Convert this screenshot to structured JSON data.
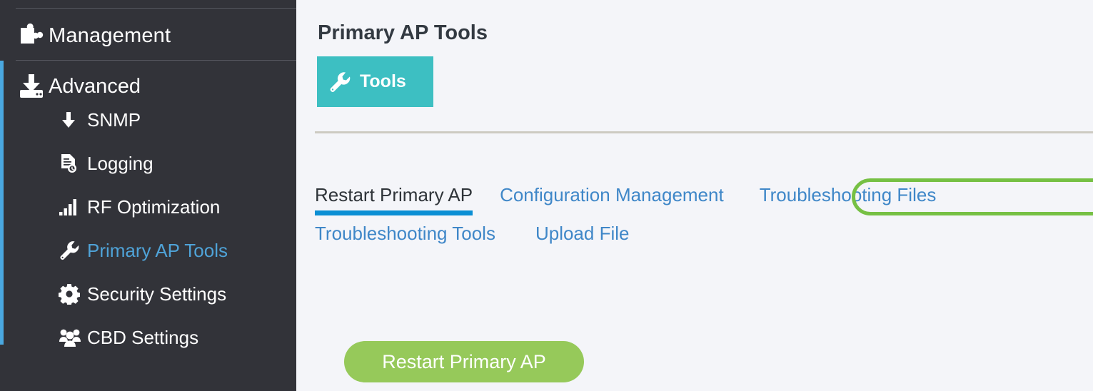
{
  "sidebar": {
    "accent_color": "#4aa8e0",
    "background_color": "#323339",
    "top_items": [
      {
        "label": "Management",
        "icon": "puzzle-piece-icon"
      },
      {
        "label": "Advanced",
        "icon": "download-tray-icon"
      }
    ],
    "sub_items": [
      {
        "label": "SNMP",
        "icon": "arrow-down-icon",
        "active": false
      },
      {
        "label": "Logging",
        "icon": "file-document-icon",
        "active": false
      },
      {
        "label": "RF Optimization",
        "icon": "signal-bars-icon",
        "active": false
      },
      {
        "label": "Primary AP Tools",
        "icon": "wrench-icon",
        "active": true
      },
      {
        "label": "Security Settings",
        "icon": "gear-icon",
        "active": false
      },
      {
        "label": "CBD Settings",
        "icon": "users-group-icon",
        "active": false
      }
    ]
  },
  "main": {
    "page_title": "Primary AP Tools",
    "tools_button": {
      "label": "Tools",
      "icon": "wrench-icon",
      "color": "#3dbfc2"
    },
    "tabs_row1": [
      {
        "label": "Restart Primary AP",
        "active": true,
        "highlighted": false
      },
      {
        "label": "Configuration Management",
        "active": false,
        "highlighted": true
      },
      {
        "label": "Troubleshooting Files",
        "active": false,
        "highlighted": false
      }
    ],
    "tabs_row2": [
      {
        "label": "Troubleshooting Tools",
        "active": false,
        "highlighted": false
      },
      {
        "label": "Upload File",
        "active": false,
        "highlighted": false
      }
    ],
    "highlight_color": "#76c044",
    "active_tab_underline_color": "#0b8fd4",
    "link_color": "#3f87c8",
    "restart_button": {
      "label": "Restart Primary AP",
      "color": "#96c95a"
    }
  }
}
